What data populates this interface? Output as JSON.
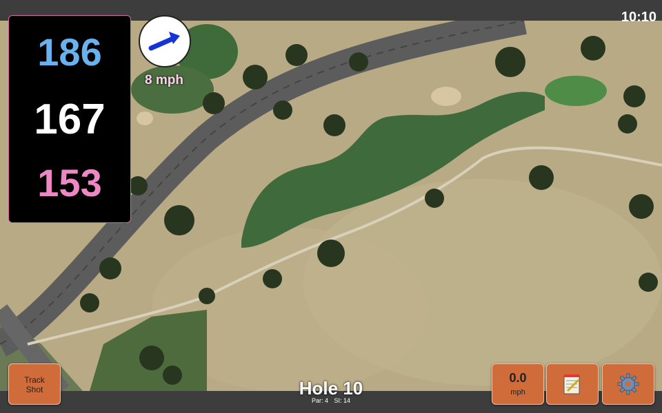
{
  "status": {
    "time": "10:10"
  },
  "distances": {
    "back": "186",
    "center": "167",
    "front": "153"
  },
  "wind": {
    "speed": "8 mph",
    "icon": "wind-arrow-icon"
  },
  "buttons": {
    "track_shot_line1": "Track",
    "track_shot_line2": "Shot",
    "speed_value": "0.0",
    "speed_unit": "mph",
    "notes_icon": "notepad-icon",
    "settings_icon": "gear-icon"
  },
  "hole": {
    "title": "Hole 10",
    "par": "Par: 4",
    "si": "SI: 14"
  },
  "colors": {
    "back": "#6ab2ee",
    "center": "#ffffff",
    "front": "#ee88c4",
    "button": "#d06b3a",
    "accent": "#d86aa8"
  }
}
